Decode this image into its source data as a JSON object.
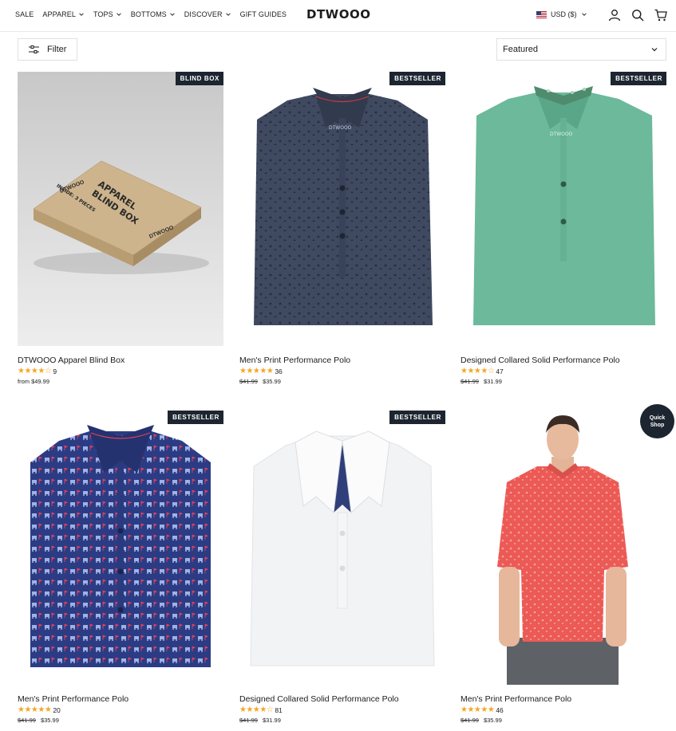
{
  "header": {
    "nav": [
      {
        "label": "SALE",
        "has_dropdown": false
      },
      {
        "label": "APPAREL",
        "has_dropdown": true
      },
      {
        "label": "TOPS",
        "has_dropdown": true
      },
      {
        "label": "BOTTOMS",
        "has_dropdown": true
      },
      {
        "label": "DISCOVER",
        "has_dropdown": true
      },
      {
        "label": "GIFT GUIDES",
        "has_dropdown": false
      }
    ],
    "logo": "DTWOOO",
    "currency": "USD ($)",
    "icons": [
      "account-icon",
      "search-icon",
      "cart-icon"
    ]
  },
  "toolbar": {
    "filter_label": "Filter",
    "sort_value": "Featured"
  },
  "products": [
    {
      "badge": "BLIND BOX",
      "title": "DTWOOO Apparel Blind Box",
      "rating": 4.5,
      "reviews": "9",
      "old_price": "",
      "price": "from $49.99",
      "image": "blind-box"
    },
    {
      "badge": "BESTSELLER",
      "title": "Men's Print Performance Polo",
      "rating": 5,
      "reviews": "36",
      "old_price": "$41.99",
      "price": "$35.99",
      "image": "navy-print-polo"
    },
    {
      "badge": "BESTSELLER",
      "title": "Designed Collared Solid Performance Polo",
      "rating": 4.5,
      "reviews": "47",
      "old_price": "$41.99",
      "price": "$31.99",
      "image": "green-solid-polo"
    },
    {
      "badge": "BESTSELLER",
      "title": "Men's Print Performance Polo",
      "rating": 5,
      "reviews": "20",
      "old_price": "$41.99",
      "price": "$35.99",
      "image": "blue-golfcart-polo"
    },
    {
      "badge": "BESTSELLER",
      "title": "Designed Collared Solid Performance Polo",
      "rating": 4.5,
      "reviews": "81",
      "old_price": "$41.99",
      "price": "$31.99",
      "image": "white-solid-polo"
    },
    {
      "badge": "",
      "title": "Men's Print Performance Polo",
      "rating": 5,
      "reviews": "46",
      "old_price": "$41.99",
      "price": "$35.99",
      "image": "coral-polo-model"
    }
  ],
  "quick_shop_label": [
    "Quick",
    "Shop"
  ],
  "colors": {
    "accent": "#1c2530",
    "star": "#f5a623",
    "border": "#e0e0e0"
  }
}
